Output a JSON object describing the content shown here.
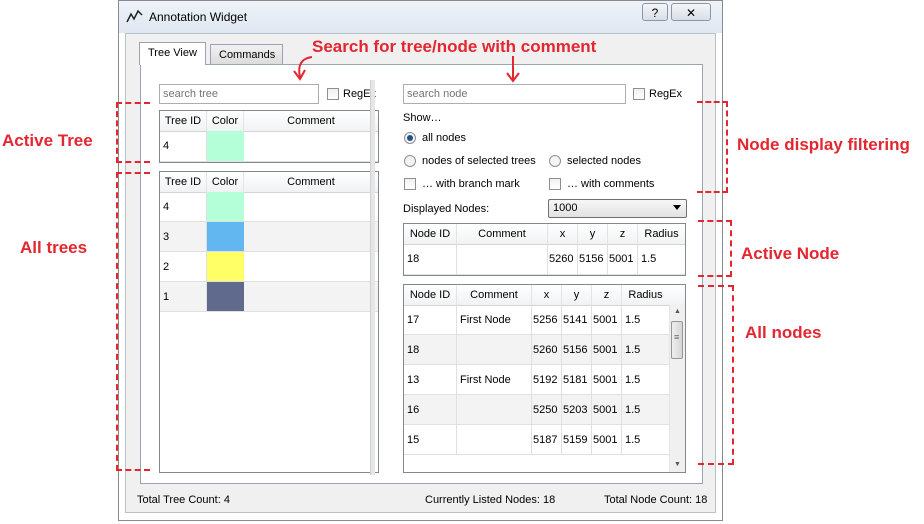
{
  "window": {
    "title": "Annotation Widget",
    "help": "?",
    "close": "✕"
  },
  "tabs": [
    {
      "label": "Tree View"
    },
    {
      "label": "Commands"
    }
  ],
  "tree_search": {
    "placeholder": "search tree",
    "regex_label": "RegEx"
  },
  "node_search": {
    "placeholder": "search node",
    "regex_label": "RegEx"
  },
  "active_tree": {
    "columns": [
      "Tree ID",
      "Color",
      "Comment"
    ],
    "rows": [
      {
        "id": "4",
        "color": "#b4ffd8",
        "comment": ""
      }
    ]
  },
  "all_trees": {
    "columns": [
      "Tree ID",
      "Color",
      "Comment"
    ],
    "rows": [
      {
        "id": "4",
        "color": "#b4ffd8",
        "comment": ""
      },
      {
        "id": "3",
        "color": "#63b7f0",
        "comment": ""
      },
      {
        "id": "2",
        "color": "#ffff66",
        "comment": ""
      },
      {
        "id": "1",
        "color": "#5f6a8c",
        "comment": ""
      }
    ]
  },
  "filter": {
    "show_label": "Show…",
    "all_nodes": "all nodes",
    "selected_trees": "nodes of selected trees",
    "selected_nodes": "selected nodes",
    "branch_mark": "… with branch mark",
    "with_comments": "… with comments",
    "displayed_label": "Displayed Nodes:",
    "displayed_value": "1000"
  },
  "active_node": {
    "columns": [
      "Node ID",
      "Comment",
      "x",
      "y",
      "z",
      "Radius"
    ],
    "rows": [
      {
        "id": "18",
        "comment": "",
        "x": "5260",
        "y": "5156",
        "z": "5001",
        "r": "1.5"
      }
    ]
  },
  "all_nodes": {
    "columns": [
      "Node ID",
      "Comment",
      "x",
      "y",
      "z",
      "Radius"
    ],
    "rows": [
      {
        "id": "17",
        "comment": "First Node",
        "x": "5256",
        "y": "5141",
        "z": "5001",
        "r": "1.5"
      },
      {
        "id": "18",
        "comment": "",
        "x": "5260",
        "y": "5156",
        "z": "5001",
        "r": "1.5"
      },
      {
        "id": "13",
        "comment": "First Node",
        "x": "5192",
        "y": "5181",
        "z": "5001",
        "r": "1.5"
      },
      {
        "id": "16",
        "comment": "",
        "x": "5250",
        "y": "5203",
        "z": "5001",
        "r": "1.5"
      },
      {
        "id": "15",
        "comment": "",
        "x": "5187",
        "y": "5159",
        "z": "5001",
        "r": "1.5"
      }
    ]
  },
  "status": {
    "tree_count": "Total Tree Count: 4",
    "listed_nodes": "Currently Listed Nodes: 18",
    "node_count": "Total Node Count: 18"
  },
  "annotations": {
    "search": "Search for tree/node with comment",
    "active_tree": "Active Tree",
    "all_trees": "All trees",
    "node_filter": "Node display filtering",
    "active_node": "Active Node",
    "all_nodes": "All nodes"
  },
  "colors": {
    "annotation": "#e32630"
  }
}
